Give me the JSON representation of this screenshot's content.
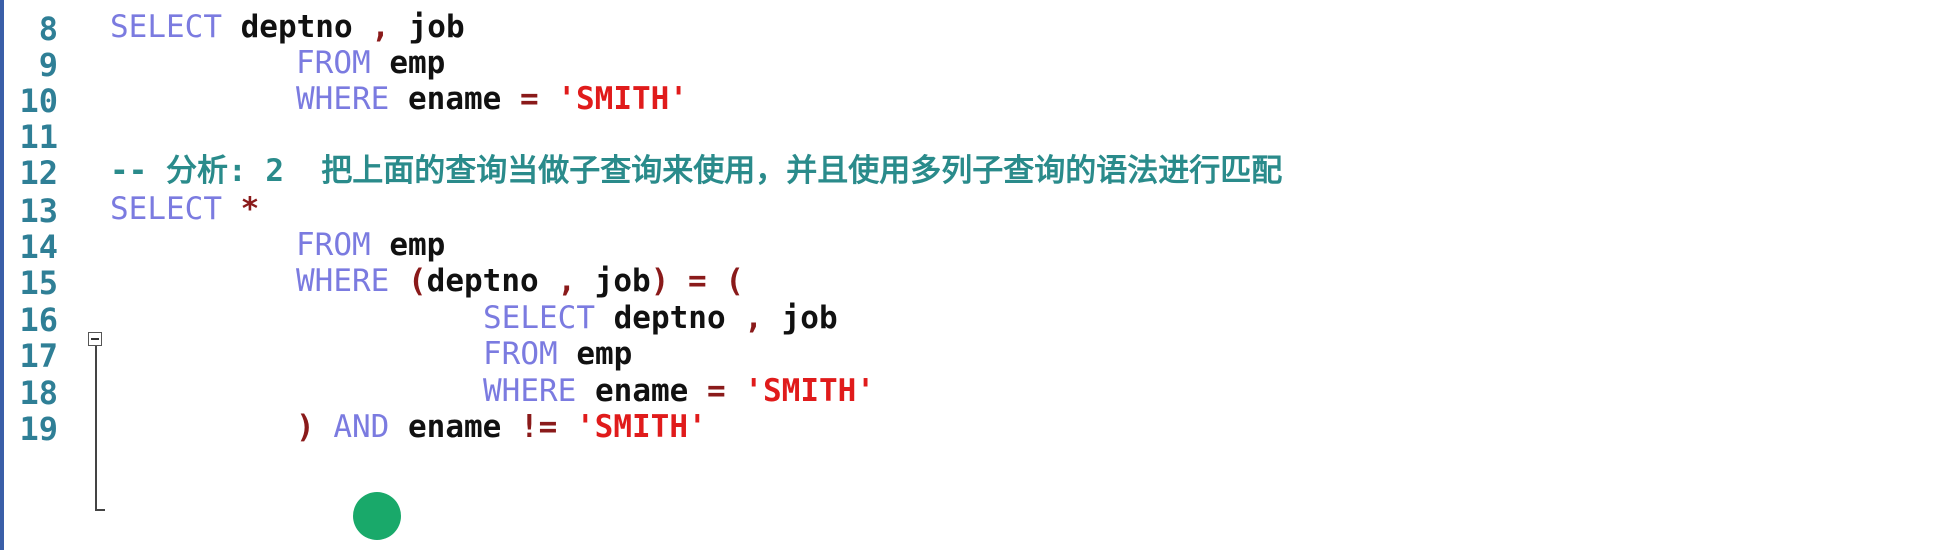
{
  "editor": {
    "lines": [
      {
        "no": "8",
        "tokens": [
          {
            "t": "SELECT",
            "c": "kw"
          },
          {
            "t": " deptno ",
            "c": "id"
          },
          {
            "t": ",",
            "c": "op"
          },
          {
            "t": " job",
            "c": "id"
          }
        ],
        "indent": 110
      },
      {
        "no": "9",
        "tokens": [
          {
            "t": "FROM",
            "c": "kw"
          },
          {
            "t": " emp",
            "c": "id"
          }
        ],
        "indent": 296
      },
      {
        "no": "10",
        "tokens": [
          {
            "t": "WHERE",
            "c": "kw"
          },
          {
            "t": " ename ",
            "c": "id"
          },
          {
            "t": "=",
            "c": "op"
          },
          {
            "t": " ",
            "c": "id"
          },
          {
            "t": "'SMITH'",
            "c": "str"
          }
        ],
        "indent": 296
      },
      {
        "no": "11",
        "tokens": [],
        "indent": 110
      },
      {
        "no": "12",
        "tokens": [
          {
            "t": "-- 分析: 2  把上面的查询当做子查询来使用，并且使用多列子查询的语法进行匹配",
            "c": "cm"
          }
        ],
        "indent": 110
      },
      {
        "no": "13",
        "tokens": [
          {
            "t": "SELECT",
            "c": "kw"
          },
          {
            "t": " ",
            "c": "id"
          },
          {
            "t": "*",
            "c": "op"
          }
        ],
        "indent": 110
      },
      {
        "no": "14",
        "tokens": [
          {
            "t": "FROM",
            "c": "kw"
          },
          {
            "t": " emp",
            "c": "id"
          }
        ],
        "indent": 296
      },
      {
        "no": "15",
        "tokens": [
          {
            "t": "WHERE",
            "c": "kw"
          },
          {
            "t": " ",
            "c": "id"
          },
          {
            "t": "(",
            "c": "op"
          },
          {
            "t": "deptno ",
            "c": "id"
          },
          {
            "t": ",",
            "c": "op"
          },
          {
            "t": " job",
            "c": "id"
          },
          {
            "t": ")",
            "c": "op"
          },
          {
            "t": " ",
            "c": "id"
          },
          {
            "t": "=",
            "c": "op"
          },
          {
            "t": " ",
            "c": "id"
          },
          {
            "t": "(",
            "c": "op"
          }
        ],
        "indent": 296
      },
      {
        "no": "16",
        "tokens": [
          {
            "t": "SELECT",
            "c": "kw"
          },
          {
            "t": " deptno ",
            "c": "id"
          },
          {
            "t": ",",
            "c": "op"
          },
          {
            "t": " job",
            "c": "id"
          }
        ],
        "indent": 483
      },
      {
        "no": "17",
        "tokens": [
          {
            "t": "FROM",
            "c": "kw"
          },
          {
            "t": " emp",
            "c": "id"
          }
        ],
        "indent": 483
      },
      {
        "no": "18",
        "tokens": [
          {
            "t": "WHERE",
            "c": "kw"
          },
          {
            "t": " ename ",
            "c": "id"
          },
          {
            "t": "=",
            "c": "op"
          },
          {
            "t": " ",
            "c": "id"
          },
          {
            "t": "'SMITH'",
            "c": "str"
          }
        ],
        "indent": 483
      },
      {
        "no": "19",
        "tokens": [
          {
            "t": ")",
            "c": "op"
          },
          {
            "t": " ",
            "c": "id"
          },
          {
            "t": "AND",
            "c": "kw"
          },
          {
            "t": " ename ",
            "c": "id"
          },
          {
            "t": "!=",
            "c": "op"
          },
          {
            "t": " ",
            "c": "id"
          },
          {
            "t": "'SMITH'",
            "c": "str"
          }
        ],
        "indent": 296
      }
    ]
  },
  "colors": {
    "keyword": "#7b7be0",
    "identifier": "#111111",
    "operator": "#8a1a1a",
    "string": "#e01b1b",
    "comment": "#2a8b8b",
    "line_number": "#2f7f96"
  }
}
